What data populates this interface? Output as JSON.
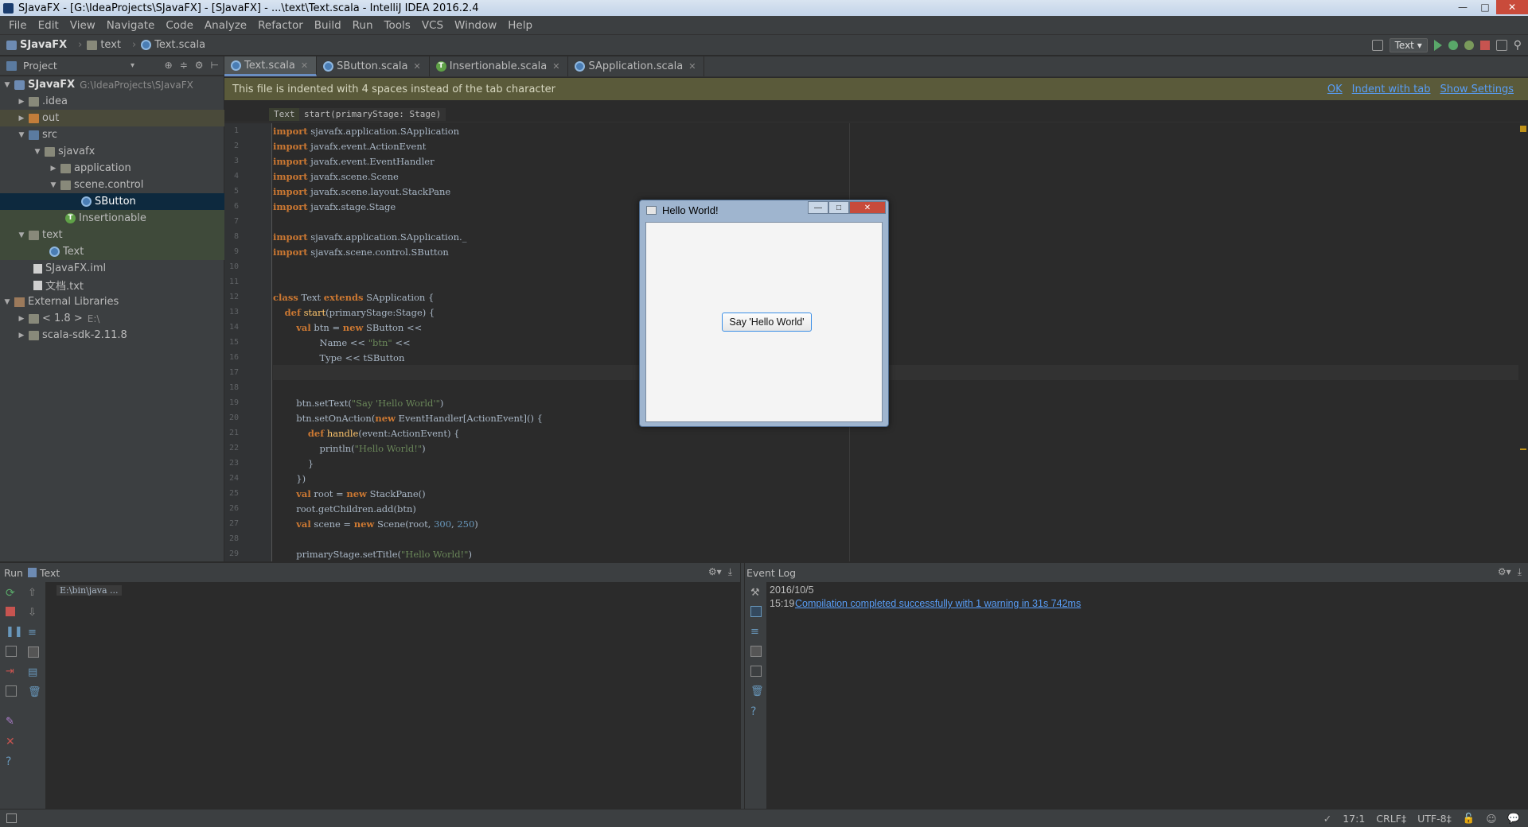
{
  "window": {
    "title": "SJavaFX - [G:\\IdeaProjects\\SJavaFX] - [SJavaFX] - ...\\text\\Text.scala - IntelliJ IDEA 2016.2.4"
  },
  "menu": [
    "File",
    "Edit",
    "View",
    "Navigate",
    "Code",
    "Analyze",
    "Refactor",
    "Build",
    "Run",
    "Tools",
    "VCS",
    "Window",
    "Help"
  ],
  "nav": {
    "project": "SJavaFX",
    "folder": "text",
    "file": "Text.scala",
    "run_config": "Text"
  },
  "project_panel": {
    "title": "Project",
    "tree": [
      {
        "label": "SJavaFX",
        "path": "G:\\IdeaProjects\\SJavaFX"
      },
      {
        "label": ".idea"
      },
      {
        "label": "out"
      },
      {
        "label": "src"
      },
      {
        "label": "sjavafx"
      },
      {
        "label": "application"
      },
      {
        "label": "scene.control"
      },
      {
        "label": "SButton"
      },
      {
        "label": "Insertionable"
      },
      {
        "label": "text"
      },
      {
        "label": "Text"
      },
      {
        "label": "SJavaFX.iml"
      },
      {
        "label": "文档.txt"
      },
      {
        "label": "External Libraries"
      },
      {
        "label": "< 1.8 >",
        "path": "E:\\"
      },
      {
        "label": "scala-sdk-2.11.8"
      }
    ]
  },
  "tabs": [
    "Text.scala",
    "SButton.scala",
    "Insertionable.scala",
    "SApplication.scala"
  ],
  "notice": {
    "text": "This file is indented with 4 spaces instead of the tab character",
    "ok": "OK",
    "indent": "Indent with tab",
    "settings": "Show Settings"
  },
  "breadcrumb": [
    "Text",
    "start(primaryStage: Stage)"
  ],
  "code": {
    "line_numbers": [
      "1",
      "2",
      "3",
      "4",
      "5",
      "6",
      "7",
      "8",
      "9",
      "10",
      "11",
      "12",
      "13",
      "14",
      "15",
      "16",
      "17",
      "18",
      "19",
      "20",
      "21",
      "22",
      "23",
      "24",
      "25",
      "26",
      "27",
      "28",
      "29"
    ],
    "lines": [
      {
        "k": "import",
        "r": " sjavafx.application.SApplication"
      },
      {
        "k": "import",
        "r": " javafx.event.ActionEvent"
      },
      {
        "k": "import",
        "r": " javafx.event.EventHandler"
      },
      {
        "k": "import",
        "r": " javafx.scene.Scene"
      },
      {
        "k": "import",
        "r": " javafx.scene.layout.StackPane"
      },
      {
        "k": "import",
        "r": " javafx.stage.Stage"
      },
      {
        "k": "",
        "r": ""
      },
      {
        "k": "import",
        "r": " sjavafx.application.SApplication._"
      },
      {
        "k": "import",
        "r": " sjavafx.scene.control.SButton"
      },
      {
        "k": "",
        "r": ""
      },
      {
        "k": "",
        "r": ""
      },
      {
        "k": "class",
        "r": " Text ",
        "k2": "extends",
        "r2": " SApplication {"
      },
      {
        "i": "    ",
        "k": "def",
        "f": " start",
        "r": "(primaryStage:Stage) {"
      },
      {
        "i": "        ",
        "k": "val",
        "r": " btn = ",
        "k2": "new",
        "r2": " SButton <<"
      },
      {
        "i": "                ",
        "r": "Name << ",
        "s": "\"btn\"",
        "r2": " <<"
      },
      {
        "i": "                ",
        "r": "Type << tSButton"
      },
      {
        "k": "",
        "r": ""
      },
      {
        "k": "",
        "r": ""
      },
      {
        "i": "        ",
        "r": "btn.setText(",
        "s": "\"Say 'Hello World'\"",
        "r2": ")"
      },
      {
        "i": "        ",
        "r": "btn.setOnAction(",
        "k2": "new",
        "r2": " EventHandler[ActionEvent]() {"
      },
      {
        "i": "            ",
        "k": "def",
        "f": " handle",
        "r": "(event:ActionEvent) {"
      },
      {
        "i": "                ",
        "r": "println(",
        "s": "\"Hello World!\"",
        "r2": ")"
      },
      {
        "i": "            ",
        "r": "}"
      },
      {
        "i": "        ",
        "r": "})"
      },
      {
        "i": "        ",
        "k": "val",
        "r": " root = ",
        "k2": "new",
        "r2": " StackPane()"
      },
      {
        "i": "        ",
        "r": "root.getChildren.add(btn)"
      },
      {
        "i": "        ",
        "k": "val",
        "r": " scene = ",
        "k2": "new",
        "r2": " Scene(root, ",
        "n": "300",
        "r3": ", ",
        "n2": "250",
        "r4": ")"
      },
      {
        "k": "",
        "r": ""
      },
      {
        "i": "        ",
        "r": "primaryStage.setTitle(",
        "s": "\"Hello World!\"",
        "r2": ")"
      }
    ]
  },
  "dialog": {
    "title": "Hello World!",
    "button": "Say 'Hello World'"
  },
  "run_panel": {
    "label": "Run",
    "config": "Text",
    "console": "E:\\bin\\java ..."
  },
  "event_log": {
    "title": "Event Log",
    "date": "2016/10/5",
    "time": "15:19",
    "message": "Compilation completed successfully with 1 warning in 31s 742ms"
  },
  "status": {
    "position": "17:1",
    "line_sep": "CRLF‡",
    "encoding": "UTF-8‡"
  }
}
